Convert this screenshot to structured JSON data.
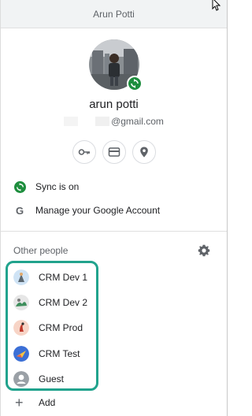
{
  "window": {
    "title": "Arun Potti"
  },
  "account": {
    "name": "arun potti",
    "email_suffix": "@gmail.com"
  },
  "quick_actions": [
    {
      "icon": "key-icon"
    },
    {
      "icon": "credit-card-icon"
    },
    {
      "icon": "location-pin-icon"
    }
  ],
  "menu": {
    "sync_label": "Sync is on",
    "manage_label": "Manage your Google Account"
  },
  "other_people": {
    "header": "Other people",
    "profiles": [
      {
        "label": "CRM Dev 1"
      },
      {
        "label": "CRM Dev 2"
      },
      {
        "label": "CRM Prod"
      },
      {
        "label": "CRM Test"
      },
      {
        "label": "Guest"
      }
    ],
    "add_label": "Add"
  },
  "colors": {
    "sync_green": "#1e8e3e",
    "highlight_teal": "#21a38d",
    "icon_gray": "#5f6368"
  }
}
